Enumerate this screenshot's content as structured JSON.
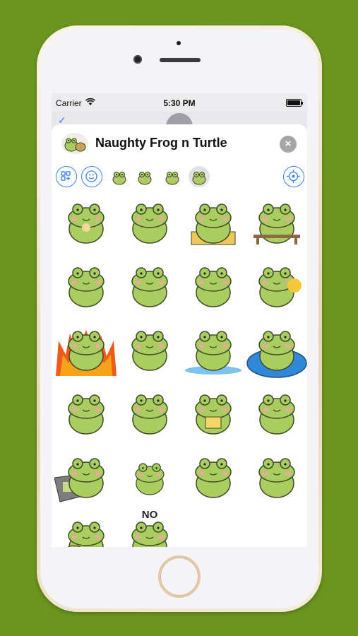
{
  "status_bar": {
    "carrier": "Carrier",
    "time": "5:30 PM"
  },
  "sheet": {
    "title": "Naughty Frog n Turtle",
    "close_icon": "×"
  },
  "tabs": [
    {
      "name": "app-grid-icon"
    },
    {
      "name": "emoji-face-icon"
    },
    {
      "name": "sticker-pack-1"
    },
    {
      "name": "sticker-pack-2"
    },
    {
      "name": "sticker-pack-3"
    },
    {
      "name": "sticker-pack-4",
      "selected": true
    },
    {
      "name": "location-target-icon"
    }
  ],
  "stickers": [
    {
      "name": "frog-eating"
    },
    {
      "name": "frog-lying-down"
    },
    {
      "name": "frog-on-box-drinking"
    },
    {
      "name": "frog-on-bench"
    },
    {
      "name": "frog-with-spoon"
    },
    {
      "name": "frog-waving"
    },
    {
      "name": "frog-shrugging"
    },
    {
      "name": "frog-with-flower"
    },
    {
      "name": "frog-angry-fire"
    },
    {
      "name": "frog-back-view"
    },
    {
      "name": "frog-crying"
    },
    {
      "name": "frog-sunglasses-floating"
    },
    {
      "name": "frog-shy"
    },
    {
      "name": "frog-scratching"
    },
    {
      "name": "frog-holding-note"
    },
    {
      "name": "frog-sitting"
    },
    {
      "name": "frog-laptop"
    },
    {
      "name": "frog-small-standing"
    },
    {
      "name": "frog-with-baby"
    },
    {
      "name": "frog-smirking"
    },
    {
      "name": "frog-with-turtle"
    },
    {
      "name": "frog-no",
      "label": "NO"
    }
  ],
  "colors": {
    "background": "#6b951f",
    "frog": "#a9cd60",
    "accent": "#3b82f6"
  }
}
